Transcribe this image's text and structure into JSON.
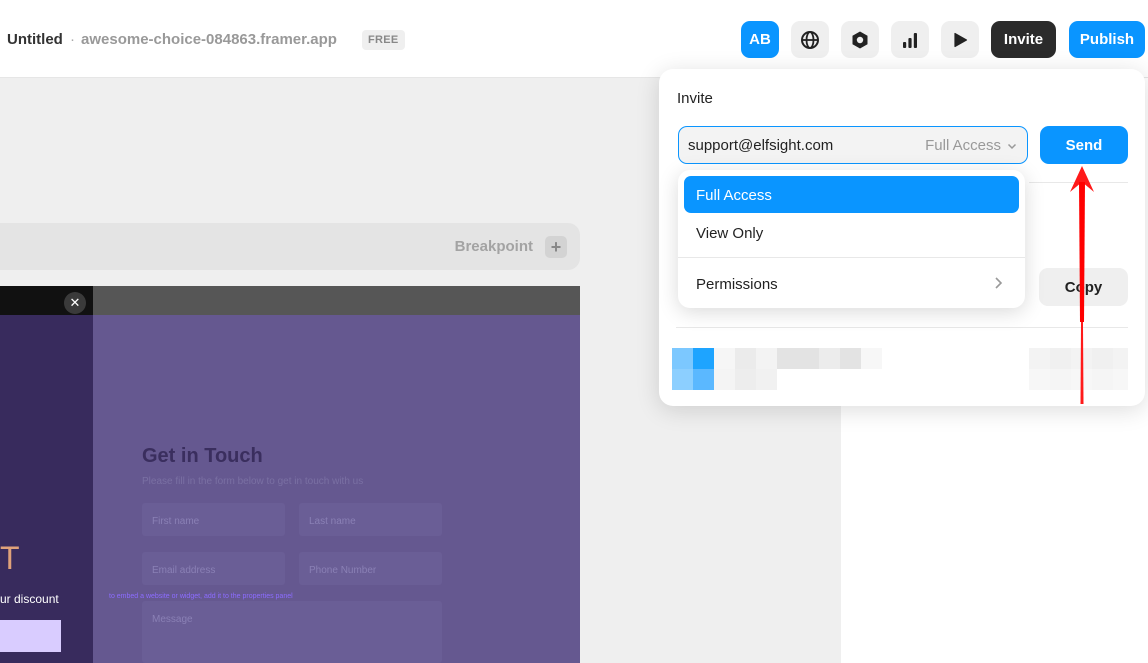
{
  "header": {
    "project_title": "Untitled",
    "separator": "·",
    "domain": "awesome-choice-084863.framer.app",
    "plan_badge": "FREE",
    "avatar_initials": "AB",
    "invite_label": "Invite",
    "publish_label": "Publish",
    "icons": [
      "globe-icon",
      "settings-hexagon-icon",
      "analytics-bars-icon",
      "play-icon"
    ]
  },
  "canvas": {
    "breakpoint_label": "Breakpoint",
    "breakpoint_add": "+",
    "close_glyph": "✕",
    "left_panel": {
      "big_letter": "T",
      "discount_text": "ur discount"
    },
    "form": {
      "title": "Get in Touch",
      "subtitle": "Please fill in the form below to get in touch with us",
      "first_name_placeholder": "First name",
      "last_name_placeholder": "Last name",
      "email_placeholder": "Email address",
      "phone_placeholder": "Phone Number",
      "message_placeholder": "Message",
      "hint": "to embed a website or widget, add it to the properties panel"
    }
  },
  "invite_popover": {
    "title": "Invite",
    "email_value": "support@elfsight.com",
    "access_value": "Full Access",
    "send_label": "Send",
    "copy_label": "Copy"
  },
  "access_dropdown": {
    "options": [
      {
        "label": "Full Access",
        "selected": true
      },
      {
        "label": "View Only",
        "selected": false
      }
    ],
    "permissions_label": "Permissions"
  },
  "colors": {
    "accent": "#0a95ff",
    "dark_button": "#2b2b2b",
    "annotation_arrow": "#ff0000"
  }
}
